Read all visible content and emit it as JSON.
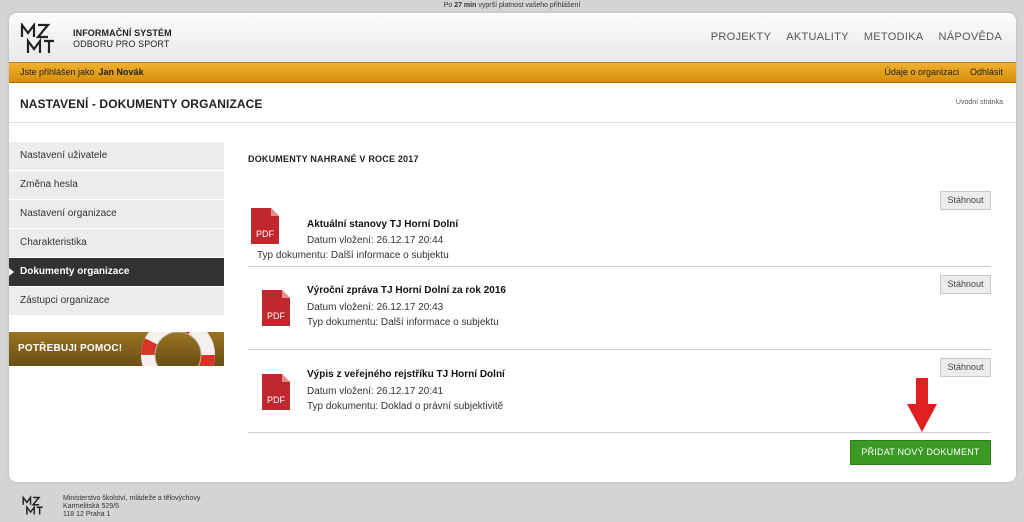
{
  "session": {
    "prefix": "Po",
    "minutes": "27 min",
    "suffix": "vyprší platnost vašeho přihlášení"
  },
  "header": {
    "logo_title_line1": "INFORMAČNÍ SYSTÉM",
    "logo_title_line2": "ODBORU PRO SPORT",
    "nav": [
      "PROJEKTY",
      "AKTUALITY",
      "METODIKA",
      "NÁPOVĚDA"
    ]
  },
  "userbar": {
    "label": "Jste přihlášen jako",
    "user": "Jan Novák",
    "links": [
      "Údaje o organizaci",
      "Odhlásit"
    ]
  },
  "page": {
    "title": "NASTAVENÍ - DOKUMENTY ORGANIZACE",
    "home_link": "Úvodní stránka"
  },
  "sidebar": {
    "items": [
      {
        "label": "Nastavení uživatele"
      },
      {
        "label": "Změna hesla"
      },
      {
        "label": "Nastavení organizace"
      },
      {
        "label": "Charakteristika"
      },
      {
        "label": "Dokumenty organizace"
      },
      {
        "label": "Zástupci organizace"
      }
    ],
    "help": "POTŘEBUJI POMOC!"
  },
  "main": {
    "section_title": "DOKUMENTY NAHRANÉ V ROCE 2017",
    "pdf_label": "PDF",
    "download_label": "Stáhnout",
    "add_button": "PŘIDAT NOVÝ DOKUMENT",
    "documents": [
      {
        "name": "Aktuální stanovy TJ Horní Dolní",
        "date": "Datum vložení: 26.12.17 20:44",
        "type": "Typ dokumentu: Další informace o subjektu"
      },
      {
        "name": "Výroční zpráva TJ Horní Dolní za rok 2016",
        "date": "Datum vložení: 26.12.17 20:43",
        "type": "Typ dokumentu: Další informace o subjektu"
      },
      {
        "name": "Výpis z veřejného rejstříku TJ Horní Dolní",
        "date": "Datum vložení: 26.12.17 20:41",
        "type": "Typ dokumentu: Doklad o právní subjektivitě"
      }
    ]
  },
  "footer": {
    "line1": "Ministerstvo školství, mládeže a tělovýchovy",
    "line2": "Karmelitská 529/5",
    "line3": "118 12 Praha 1"
  },
  "colors": {
    "userbar": "#e3a11c",
    "active_item": "#323232",
    "add_button": "#3a9a24",
    "pdf_icon": "#c0282d",
    "arrow": "#e02020"
  }
}
